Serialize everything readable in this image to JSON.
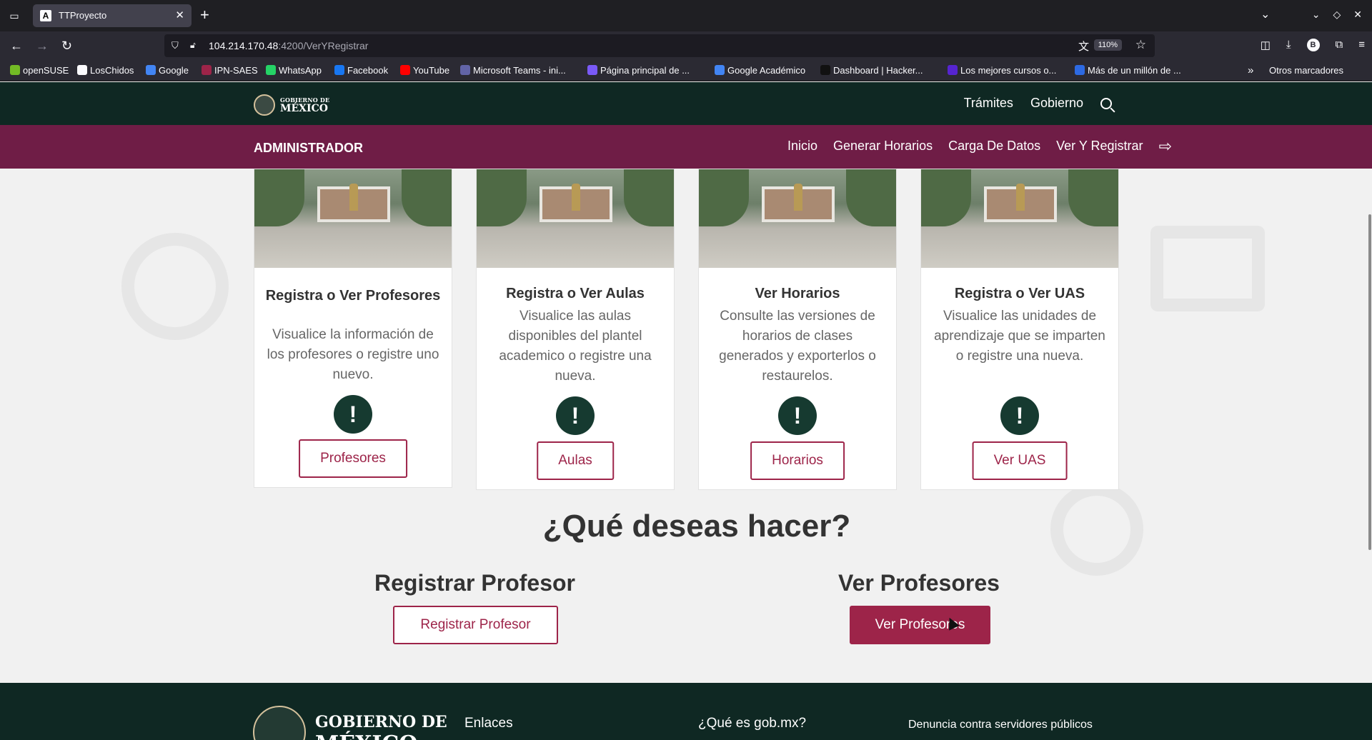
{
  "browser": {
    "tab": {
      "title": "TTProyecto",
      "favicon": "A"
    },
    "url": {
      "host": "104.214.170.48",
      "path": ":4200/VerYRegistrar"
    },
    "zoom": "110%",
    "profile_initial": "B",
    "bookmarks": [
      {
        "label": "openSUSE",
        "color": "#73ba25"
      },
      {
        "label": "LosChidos",
        "color": "#fbfbfe"
      },
      {
        "label": "Google",
        "color": "#4285f4"
      },
      {
        "label": "IPN-SAES",
        "color": "#9d2449"
      },
      {
        "label": "WhatsApp",
        "color": "#25d366"
      },
      {
        "label": "Facebook",
        "color": "#1877f2"
      },
      {
        "label": "YouTube",
        "color": "#ff0000"
      },
      {
        "label": "Microsoft Teams - ini...",
        "color": "#6264a7"
      },
      {
        "label": "Página principal de ...",
        "color": "#7a5af8"
      },
      {
        "label": "Google Académico",
        "color": "#4285f4"
      },
      {
        "label": "Dashboard | Hacker...",
        "color": "#111111"
      },
      {
        "label": "Los mejores cursos o...",
        "color": "#5624d0"
      },
      {
        "label": "Más de un millón de ...",
        "color": "#2d6ae3"
      }
    ],
    "other_bookmarks": "Otros marcadores"
  },
  "gov_header": {
    "logo_line1": "GOBIERNO DE",
    "logo_line2": "MÉXICO",
    "links": [
      "Trámites",
      "Gobierno"
    ]
  },
  "admin_bar": {
    "title": "ADMINISTRADOR",
    "nav": [
      "Inicio",
      "Generar Horarios",
      "Carga De Datos",
      "Ver Y Registrar"
    ]
  },
  "cards": [
    {
      "title": "Registra o Ver Profesores",
      "desc": "Visualice la información de los profesores o registre uno nuevo.",
      "alert": "!",
      "button": "Profesores"
    },
    {
      "title": "Registra o Ver Aulas",
      "desc": "Visualice las aulas disponibles del plantel academico o registre una nueva.",
      "alert": "!",
      "button": "Aulas"
    },
    {
      "title": "Ver Horarios",
      "desc": "Consulte las versiones de horarios de clases generados y exporterlos o restaurelos.",
      "alert": "!",
      "button": "Horarios"
    },
    {
      "title": "Registra o Ver UAS",
      "desc": "Visualice las unidades de aprendizaje que se imparten o registre una nueva.",
      "alert": "!",
      "button": "Ver UAS"
    }
  ],
  "question": "¿Qué deseas hacer?",
  "options": [
    {
      "title": "Registrar Profesor",
      "button": "Registrar Profesor"
    },
    {
      "title": "Ver Profesores",
      "button": "Ver Profesores"
    }
  ],
  "footer": {
    "logo_line1": "GOBIERNO DE",
    "logo_line2": "MÉXICO",
    "columns": [
      "Enlaces",
      "¿Qué es gob.mx?",
      "Denuncia contra servidores públicos"
    ]
  },
  "colors": {
    "gov_green": "#0f2823",
    "guinda": "#6f1d46",
    "button_red": "#9d2449"
  }
}
